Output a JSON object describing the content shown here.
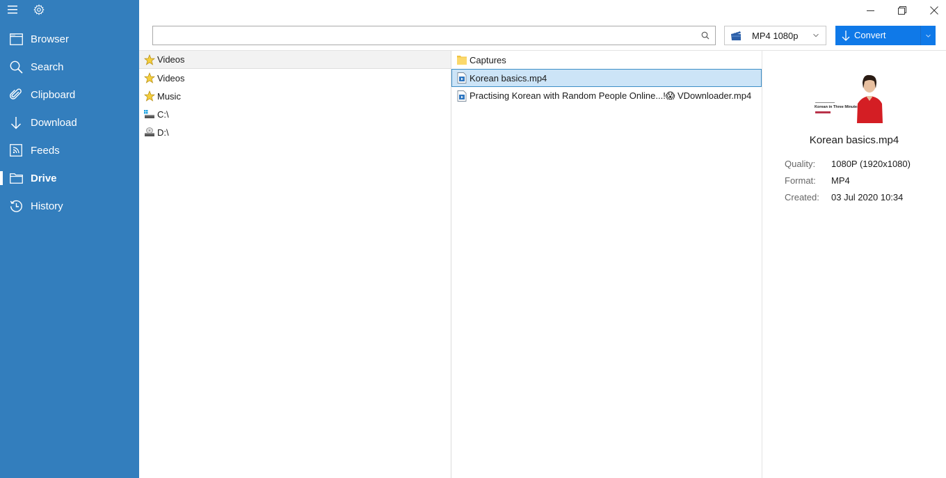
{
  "window": {
    "controls": [
      "minimize",
      "restore",
      "close"
    ]
  },
  "sidebar": {
    "top_icons": [
      "hamburger-menu-icon",
      "gear-icon"
    ],
    "items": [
      {
        "label": "Browser",
        "icon": "browser-window-icon",
        "active": false
      },
      {
        "label": "Search",
        "icon": "search-icon",
        "active": false
      },
      {
        "label": "Clipboard",
        "icon": "paperclip-icon",
        "active": false
      },
      {
        "label": "Download",
        "icon": "download-arrow-icon",
        "active": false
      },
      {
        "label": "Feeds",
        "icon": "rss-feed-icon",
        "active": false
      },
      {
        "label": "Drive",
        "icon": "folder-icon",
        "active": true
      },
      {
        "label": "History",
        "icon": "history-clock-icon",
        "active": false
      }
    ]
  },
  "toolbar": {
    "search": {
      "value": "",
      "placeholder": ""
    },
    "format": {
      "selected": "MP4 1080p",
      "icon": "clapperboard-icon"
    },
    "convert": {
      "label": "Convert"
    }
  },
  "tree": {
    "items": [
      {
        "label": "Videos",
        "icon": "star-icon",
        "selected": true
      },
      {
        "label": "Videos",
        "icon": "star-icon",
        "selected": false
      },
      {
        "label": "Music",
        "icon": "star-icon",
        "selected": false
      },
      {
        "label": "C:\\",
        "icon": "system-drive-icon",
        "selected": false
      },
      {
        "label": "D:\\",
        "icon": "disc-drive-icon",
        "selected": false
      }
    ]
  },
  "files": {
    "items": [
      {
        "label": "Captures",
        "icon": "folder-icon",
        "selected": false
      },
      {
        "label": "Korean basics.mp4",
        "icon": "video-file-icon",
        "selected": true
      },
      {
        "label": "Practising Korean with Random People Online...!😱 VDownloader.mp4",
        "icon": "video-file-icon",
        "selected": false
      }
    ]
  },
  "details": {
    "thumbnail_caption": "Korean in Three Minutes",
    "title": "Korean basics.mp4",
    "props": [
      {
        "key": "Quality:",
        "value": "1080P (1920x1080)"
      },
      {
        "key": "Format:",
        "value": "MP4"
      },
      {
        "key": "Created:",
        "value": "03 Jul 2020 10:34"
      }
    ]
  },
  "colors": {
    "sidebar_bg": "#337ebd",
    "accent": "#0f79e8",
    "selection": "#cce4f7"
  }
}
